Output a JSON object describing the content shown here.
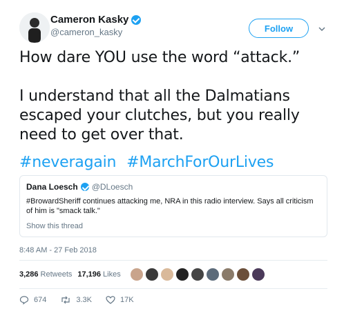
{
  "author": {
    "name": "Cameron Kasky",
    "handle": "@cameron_kasky"
  },
  "follow_label": "Follow",
  "tweet": {
    "line1": "How dare YOU use the word “attack.”",
    "line2": "I understand that all the Dalmatians escaped your clutches, but you really need to get over that.",
    "hashtags": [
      "#neveragain",
      "#MarchForOurLives"
    ]
  },
  "quote": {
    "name": "Dana Loesch",
    "handle": "@DLoesch",
    "text": "#BrowardSheriff continues attacking me, NRA in this radio interview. Says all criticism of him is \"smack talk.\"",
    "show_thread": "Show this thread"
  },
  "timestamp": "8:48 AM - 27 Feb 2018",
  "stats": {
    "retweets_count": "3,286",
    "retweets_label": "Retweets",
    "likes_count": "17,196",
    "likes_label": "Likes"
  },
  "liker_colors": [
    "#c9a48c",
    "#3a3a3a",
    "#d9b99a",
    "#222222",
    "#444444",
    "#5c6b7a",
    "#8a7b6a",
    "#6b4f3a",
    "#4b3a5a"
  ],
  "actions": {
    "replies": "674",
    "retweets": "3.3K",
    "likes": "17K"
  },
  "colors": {
    "accent": "#1da1f2",
    "muted": "#657786"
  }
}
